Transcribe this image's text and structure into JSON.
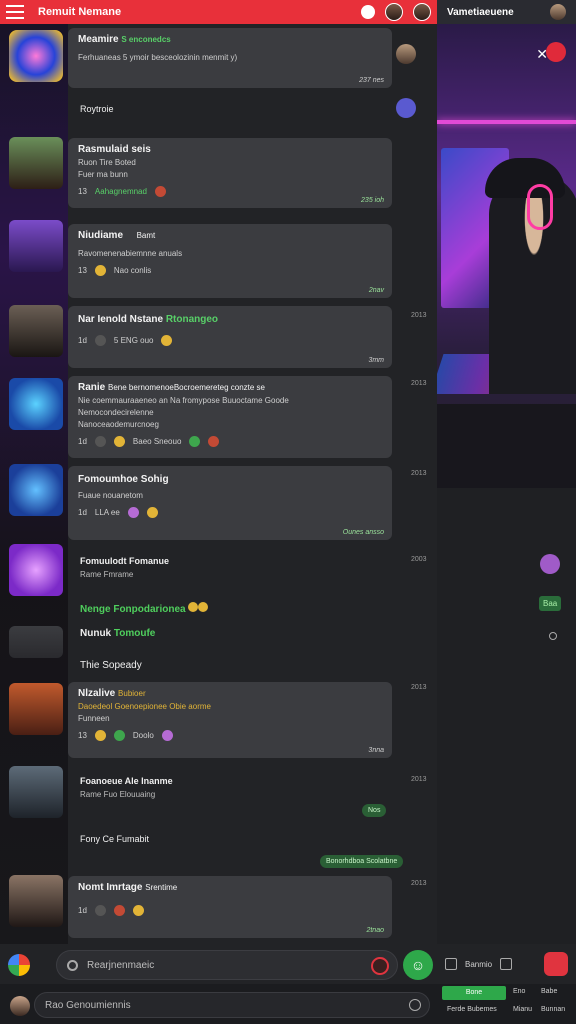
{
  "topbar": {
    "title": "Remuit Nemane",
    "right_title": "Vametiaeuene"
  },
  "feed": [
    {
      "name": "Meamire",
      "tag": "S enconedcs",
      "body": "Ferhuaneas 5 ymoir besceolozinin menmit y)",
      "time": "",
      "meta": "237 nes"
    },
    {
      "name": "Roytroie",
      "tag": "",
      "body": "",
      "time": "",
      "meta": ""
    },
    {
      "name": "Rasmulaid seis",
      "tag": "Ruon Tire Boted",
      "body": "Fuer ma bunn",
      "count": "13",
      "reaction": "Aahagnemnad",
      "meta": "235 ioh"
    },
    {
      "name": "Niudiame",
      "tag": "Bamt",
      "body": "Ravomenenabiemnne anuals",
      "count": "13",
      "reaction": "Nao conlis",
      "meta": "2nav"
    },
    {
      "name": "Nar Ienold Nstane",
      "tag": "Rtonangeo",
      "body": "",
      "count": "1d",
      "reaction": "5 ENG ouo",
      "meta": "3mm",
      "time": "2013"
    },
    {
      "name": "Ranie",
      "tag": "",
      "body": "Bene bernomenoeBocroemereteg conzte se",
      "body2": "Nie coemmauraaeneo an Na fromypose Buuoctame Goode",
      "body3": "Nemocondecirelenne",
      "body4": "Nanoceaodemurcnoeg",
      "count": "1d",
      "reaction": "Baeo Sneouo",
      "time": "2013"
    },
    {
      "name": "Fomoumhoe Sohig",
      "tag": "",
      "body": "Fuaue nouanetom",
      "count": "1d",
      "reaction": "LLA ee",
      "meta": "Ounes ansso",
      "time": "2013"
    },
    {
      "name": "Fomuulodt Fomanue",
      "tag": "",
      "body": "Rame Fmrame",
      "time": "2003"
    },
    {
      "name": "Nenge Fonpodarionea",
      "time": ""
    },
    {
      "name": "Nunuk",
      "tag": "Tomoufe",
      "time": ""
    },
    {
      "name": "Thie",
      "tag": "Sopeady",
      "time": ""
    },
    {
      "name": "Nlzalive",
      "tag": "Bubioer",
      "body": "Daoedeol Goenoepionee Obie aorme",
      "body2": "Funneen",
      "count": "13",
      "reaction": "Doolo",
      "meta": "3nna",
      "time": "2013"
    },
    {
      "name": "Foanoeue Ale Inanme",
      "tag": "",
      "body": "Rame Fuo Elouuaing",
      "time": "2013"
    },
    {
      "name": "Fony Ce Fumabit",
      "time": ""
    },
    {
      "name": "Nomt Imrtage",
      "tag": "Srentime",
      "count": "1d",
      "reaction": "",
      "meta": "2tnao",
      "time": "2013"
    }
  ],
  "chips": {
    "one": "Nos",
    "two": "Bonorhdboa Scolatbne"
  },
  "side_badge": "Baa",
  "composer": {
    "placeholder": "Rearjnenmaeic",
    "side_label": "Banmio"
  },
  "side_tabs": {
    "active": "Bone",
    "t2": "Eno",
    "t3": "Babe",
    "t4": "Ferde Bubemes",
    "t5": "Mianu",
    "t6": "Bunnan"
  },
  "bottom_input": "Rao Genoumiennis"
}
